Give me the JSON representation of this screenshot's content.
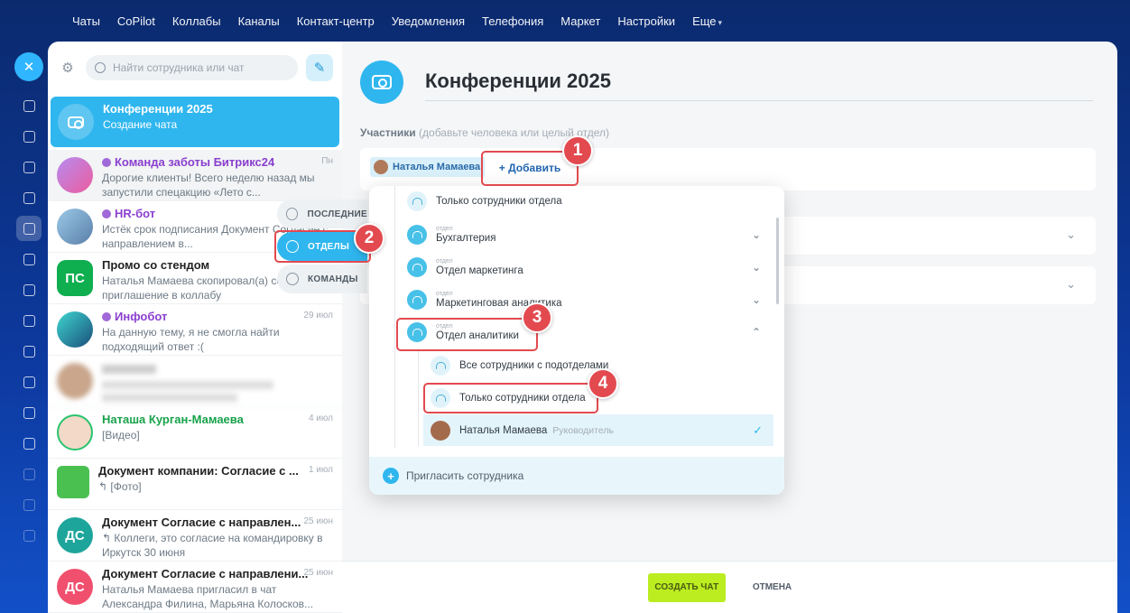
{
  "topnav": {
    "items": [
      "Чаты",
      "CoPilot",
      "Коллабы",
      "Каналы",
      "Контакт-центр",
      "Уведомления",
      "Телефония",
      "Маркет",
      "Настройки",
      "Еще"
    ]
  },
  "search": {
    "placeholder": "Найти сотрудника или чат"
  },
  "chats": [
    {
      "title": "Конференции 2025",
      "preview": "Создание чата",
      "date": ""
    },
    {
      "title": "Команда заботы Битрикс24",
      "preview": "Дорогие клиенты! Всего неделю назад мы запустили спецакцию «Лето с...",
      "date": "Пн"
    },
    {
      "title": "HR-бот",
      "preview": "Истёк срок подписания Документ Согласие с направлением в...",
      "date": ""
    },
    {
      "title": "Промо со стендом",
      "preview": "Наталья Мамаева скопировал(а) ссылку на приглашение в коллабу",
      "date": "",
      "initials": "ПС"
    },
    {
      "title": "Инфобот",
      "preview": "На данную тему, я не смогла найти подходящий ответ :(",
      "date": "29 июл"
    },
    {
      "title": "Наташа Курган-Мамаева",
      "preview": "[Видео]",
      "date": "4 июл"
    },
    {
      "title": "Документ компании: Согласие с ...",
      "preview": "↰ [Фото]",
      "date": "1 июл"
    },
    {
      "title": "Документ Согласие с направлен...",
      "preview": "↰ Коллеги, это согласие на командировку в Иркутск 30 июня",
      "date": "25 июн",
      "initials": "ДС"
    },
    {
      "title": "Документ Согласие с направлени...",
      "preview": "Наталья Мамаева пригласил в чат Александра Филина, Марьяна Колосков...",
      "date": "25 июн",
      "initials": "ДС"
    }
  ],
  "tabs": {
    "recent": "ПОСЛЕДНИЕ",
    "departments": "ОТДЕЛЫ",
    "teams": "КОМАНДЫ"
  },
  "main": {
    "chat_name": "Конференции 2025",
    "participants_label": "Участники",
    "participants_hint": "(добавьте человека или целый отдел)",
    "chip_name": "Наталья Мамаева",
    "add_label": "+ Добавить"
  },
  "dropdown": {
    "top_item": "Только сотрудники отдела",
    "dept_caption": "отдел",
    "departments": [
      "Бухгалтерия",
      "Отдел маркетинга",
      "Маркетинговая аналитика",
      "Отдел аналитики"
    ],
    "sub_all": "Все сотрудники с подотделами",
    "sub_only": "Только сотрудники отдела",
    "user_name": "Наталья Мамаева",
    "user_role": "Руководитель",
    "invite": "Пригласить сотрудника"
  },
  "footer": {
    "create": "СОЗДАТЬ ЧАТ",
    "cancel": "ОТМЕНА"
  },
  "badges": [
    "1",
    "2",
    "3",
    "4"
  ],
  "colors": {
    "accent": "#2fb6ef",
    "create": "#bbed21",
    "callout": "#e24a4f"
  }
}
